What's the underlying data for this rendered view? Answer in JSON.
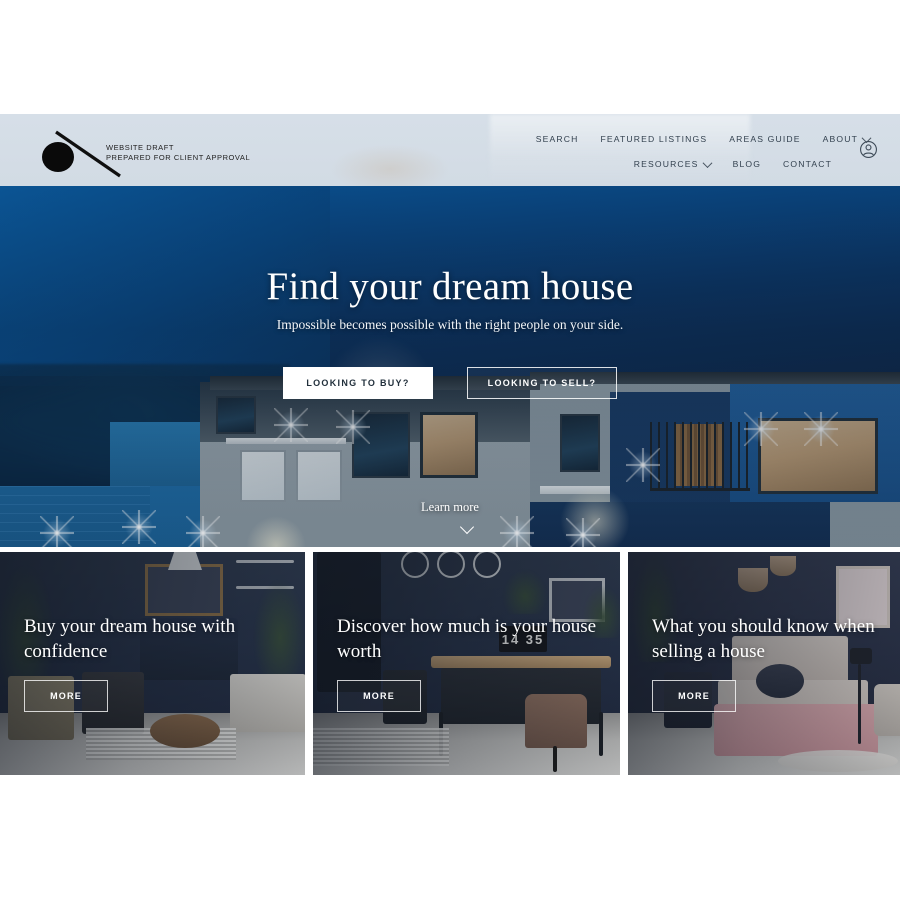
{
  "header": {
    "logo": {
      "line1": "WEBSITE DRAFT",
      "line2": "PREPARED FOR CLIENT APPROVAL"
    },
    "nav_row1": [
      {
        "label": "SEARCH",
        "has_chevron": false
      },
      {
        "label": "FEATURED LISTINGS",
        "has_chevron": false
      },
      {
        "label": "AREAS GUIDE",
        "has_chevron": false
      },
      {
        "label": "ABOUT",
        "has_chevron": true
      }
    ],
    "nav_row2": [
      {
        "label": "RESOURCES",
        "has_chevron": true
      },
      {
        "label": "BLOG",
        "has_chevron": false
      },
      {
        "label": "CONTACT",
        "has_chevron": false
      }
    ],
    "account_icon": "user-account-icon",
    "background_color": "#d4dde6",
    "text_color": "#33414f"
  },
  "hero": {
    "title": "Find your dream house",
    "subtitle": "Impossible becomes possible with the right people on your side.",
    "cta_primary": "LOOKING TO BUY?",
    "cta_secondary": "LOOKING TO SELL?",
    "learn_more": "Learn more",
    "scroll_icon": "chevron-down-icon",
    "image_description": "Modern two-story house at twilight with illuminated windows"
  },
  "cards": [
    {
      "title": "Buy your dream house with confidence",
      "button": "MORE",
      "image_description": "Dark blue living room with armchairs and framed art"
    },
    {
      "title": "Discover how much is your house worth",
      "button": "MORE",
      "image_description": "Home office with desk, chair and wall clocks",
      "clock_value": "14 35"
    },
    {
      "title": "What you should know when selling a house",
      "button": "MORE",
      "image_description": "Navy bedroom with pink knitted blanket and pendant lamps"
    }
  ]
}
